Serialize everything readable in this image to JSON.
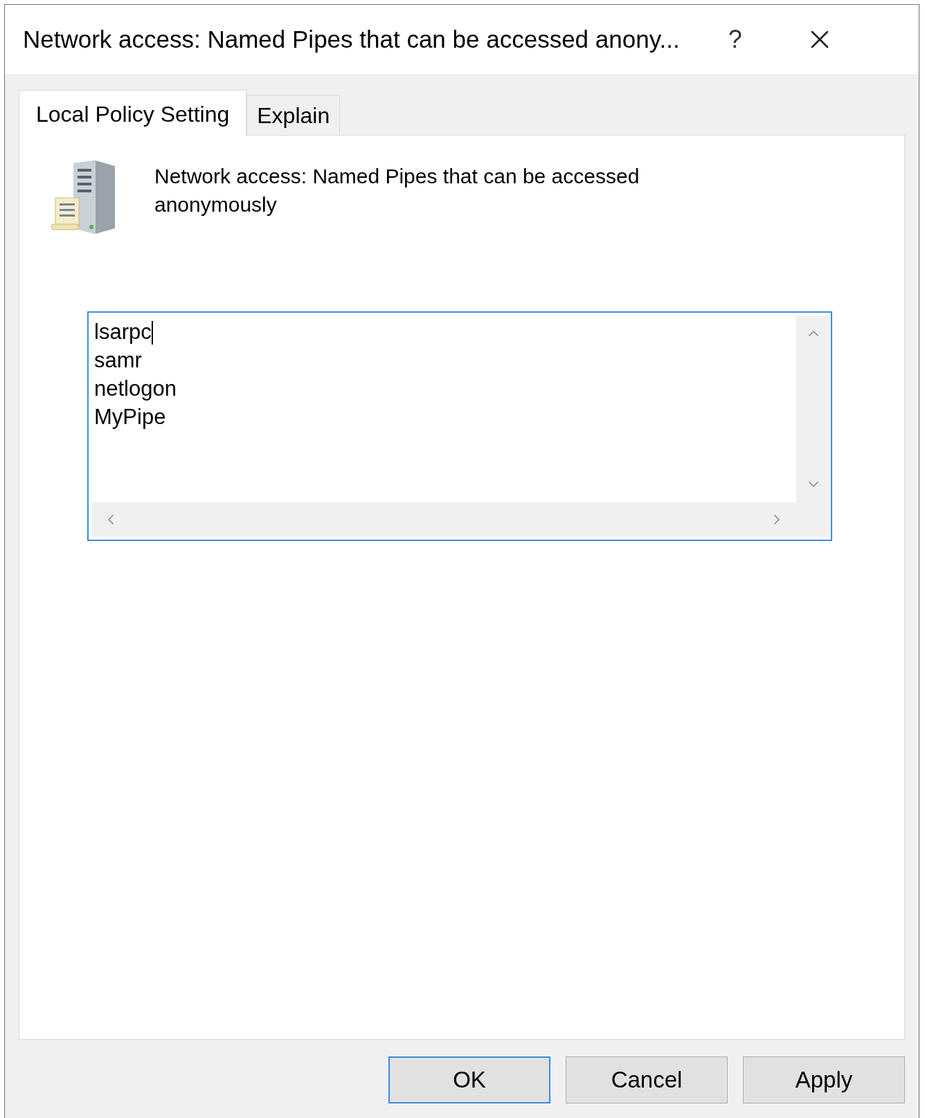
{
  "window": {
    "title": "Network access: Named Pipes that can be accessed anony...",
    "help": "?"
  },
  "tabs": [
    {
      "label": "Local Policy Setting",
      "selected": true
    },
    {
      "label": "Explain",
      "selected": false
    }
  ],
  "policy": {
    "title": "Network access: Named Pipes that can be accessed anonymously"
  },
  "text_area": {
    "lines": [
      "lsarpc",
      "samr",
      "netlogon",
      "MyPipe"
    ],
    "focused": true
  },
  "buttons": [
    {
      "label": "OK",
      "default": true
    },
    {
      "label": "Cancel",
      "default": false
    },
    {
      "label": "Apply",
      "default": false
    }
  ]
}
